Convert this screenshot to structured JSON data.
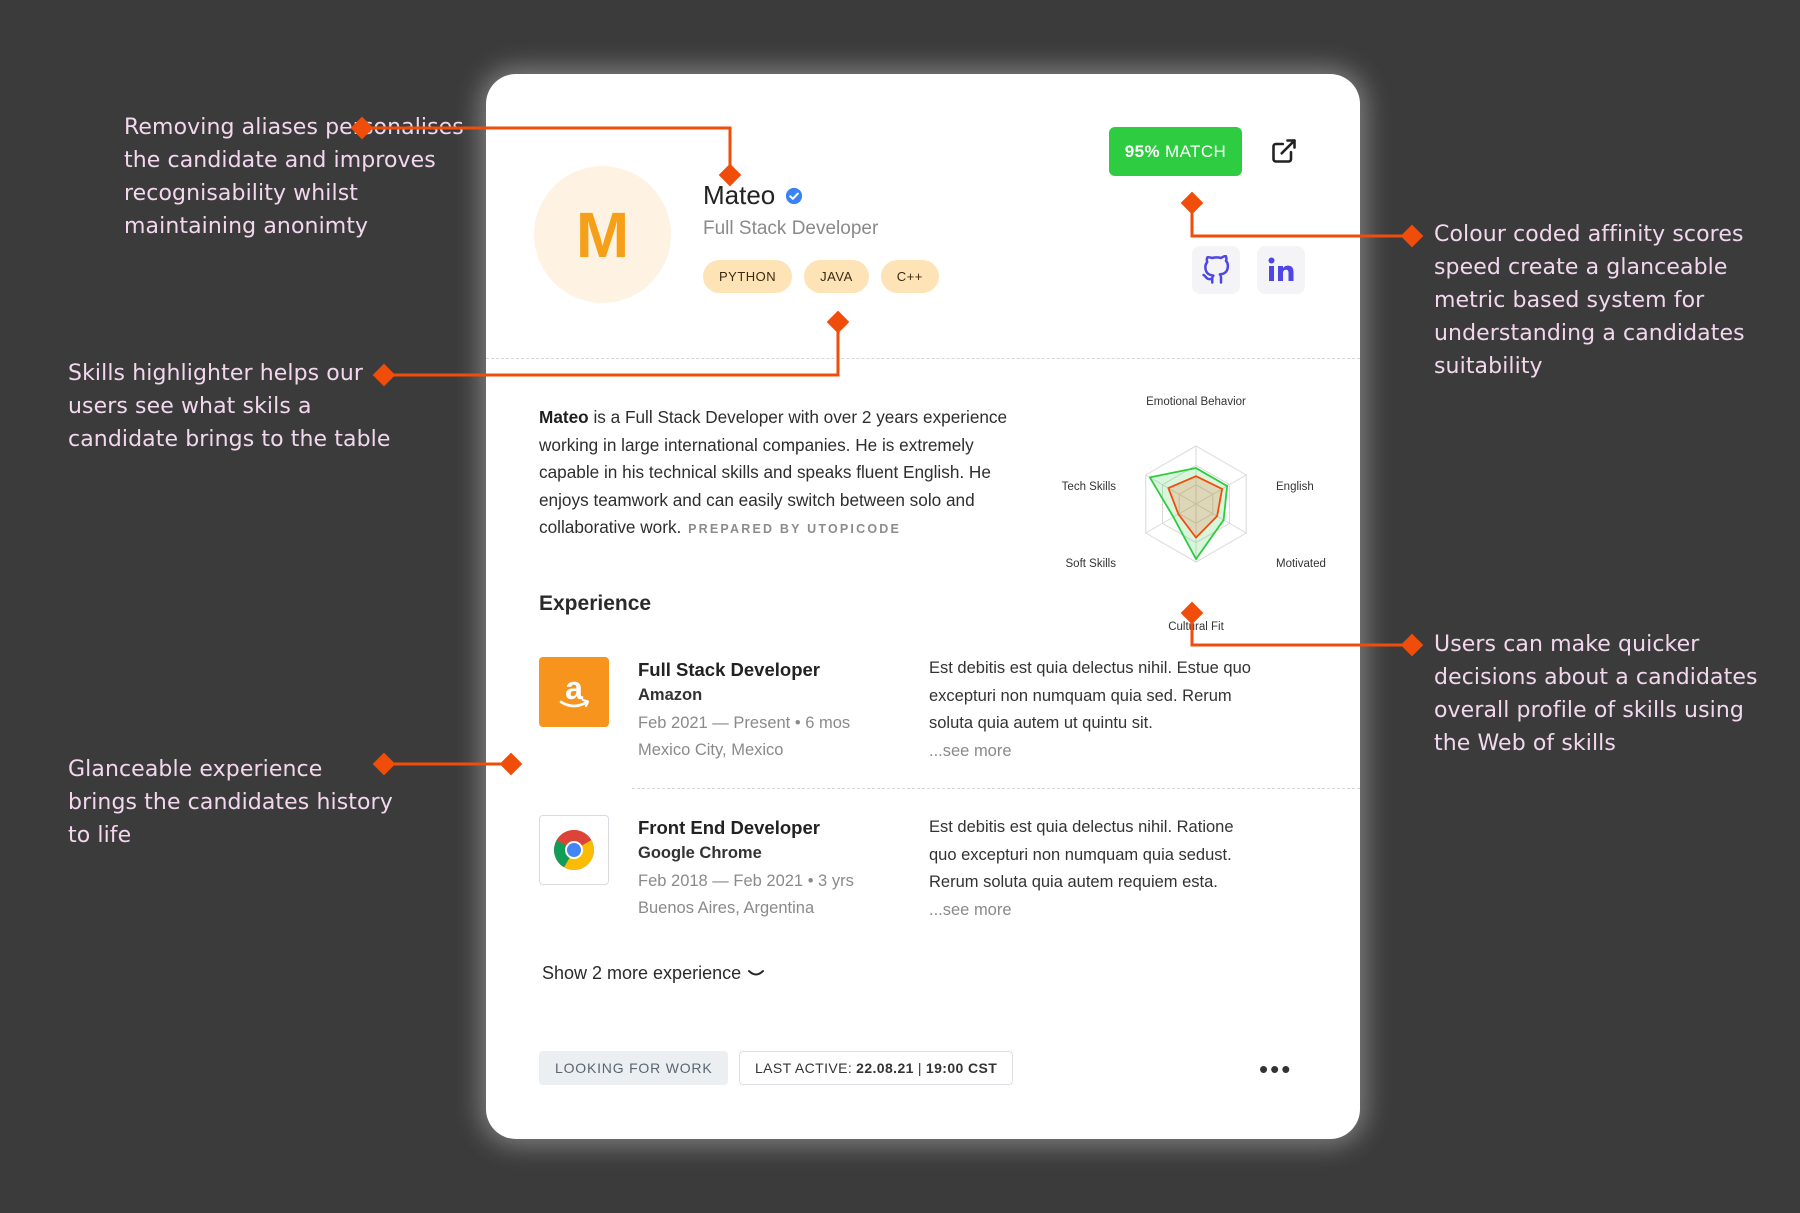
{
  "annotations": {
    "aliases": "Removing aliases personalises the candidate and improves recognisability whilst maintaining anonimty",
    "skills": "Skills highlighter helps our users see what skils a candidate brings to the table",
    "experience": "Glanceable experience brings the candidates history to life",
    "affinity": "Colour coded affinity scores speed create a glanceable metric based system for understanding a candidates suitability",
    "web": "Users can make quicker decisions about a candidates overall profile of skills using the Web of skills"
  },
  "colors": {
    "accent": "#f04d0a",
    "match": "#2ecc40",
    "avatar_bg": "#fef3e2",
    "avatar_fg": "#f6a01a",
    "skill_bg": "#fde3b6"
  },
  "profile": {
    "initial": "M",
    "name": "Mateo",
    "role": "Full Stack Developer",
    "skills": [
      "PYTHON",
      "JAVA",
      "C++"
    ],
    "match_value": "95%",
    "match_label": "MATCH"
  },
  "bio": {
    "name": "Mateo",
    "text": " is a Full Stack Developer with over 2 years experience working in large international companies. He is extremely capable in his technical skills and speaks fluent English. He enjoys teamwork and can easily switch between solo and collaborative work.",
    "prepared_by": "PREPARED BY UTOPICODE"
  },
  "chart_data": {
    "type": "radar",
    "axes": [
      "Emotional Behavior",
      "English",
      "Motivated",
      "Cultural Fit",
      "Soft Skills",
      "Tech Skills"
    ],
    "levels": 3,
    "series": [
      {
        "values": [
          0.62,
          0.62,
          0.55,
          0.95,
          0.45,
          0.92
        ],
        "color": "#2ecc40"
      },
      {
        "values": [
          0.48,
          0.52,
          0.42,
          0.58,
          0.35,
          0.55
        ],
        "color": "#f04d0a"
      }
    ]
  },
  "experience": {
    "title": "Experience",
    "items": [
      {
        "title": "Full Stack Developer",
        "company": "Amazon",
        "dates": "Feb 2021 — Present • 6 mos",
        "location": "Mexico City, Mexico",
        "desc": "Est debitis est quia delectus nihil. Estue quo excepturi non numquam quia sed. Rerum soluta quia autem ut quintu sit.",
        "more": "...see more",
        "logo_icon": "amazon-logo-icon"
      },
      {
        "title": "Front End Developer",
        "company": "Google Chrome",
        "dates": "Feb 2018 — Feb 2021 • 3 yrs",
        "location": "Buenos Aires, Argentina",
        "desc": "Est debitis est quia delectus nihil. Ratione quo excepturi non numquam quia sedust. Rerum soluta quia autem requiem esta.",
        "more": "...see more",
        "logo_icon": "chrome-logo-icon"
      }
    ],
    "show_more": "Show 2 more experience"
  },
  "footer": {
    "status": "LOOKING FOR WORK",
    "last_active_label": "LAST ACTIVE:",
    "last_active_date": "22.08.21",
    "last_active_sep": "|",
    "last_active_time": "19:00 CST",
    "more_menu": "•••"
  }
}
